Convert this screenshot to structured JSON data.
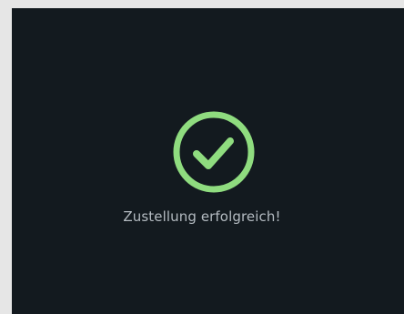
{
  "dialog": {
    "status_message": "Zustellung erfolgreich!",
    "status_icon": "check-circle-icon",
    "accent_color": "#8fdc7f",
    "background_color": "#131a1f"
  }
}
